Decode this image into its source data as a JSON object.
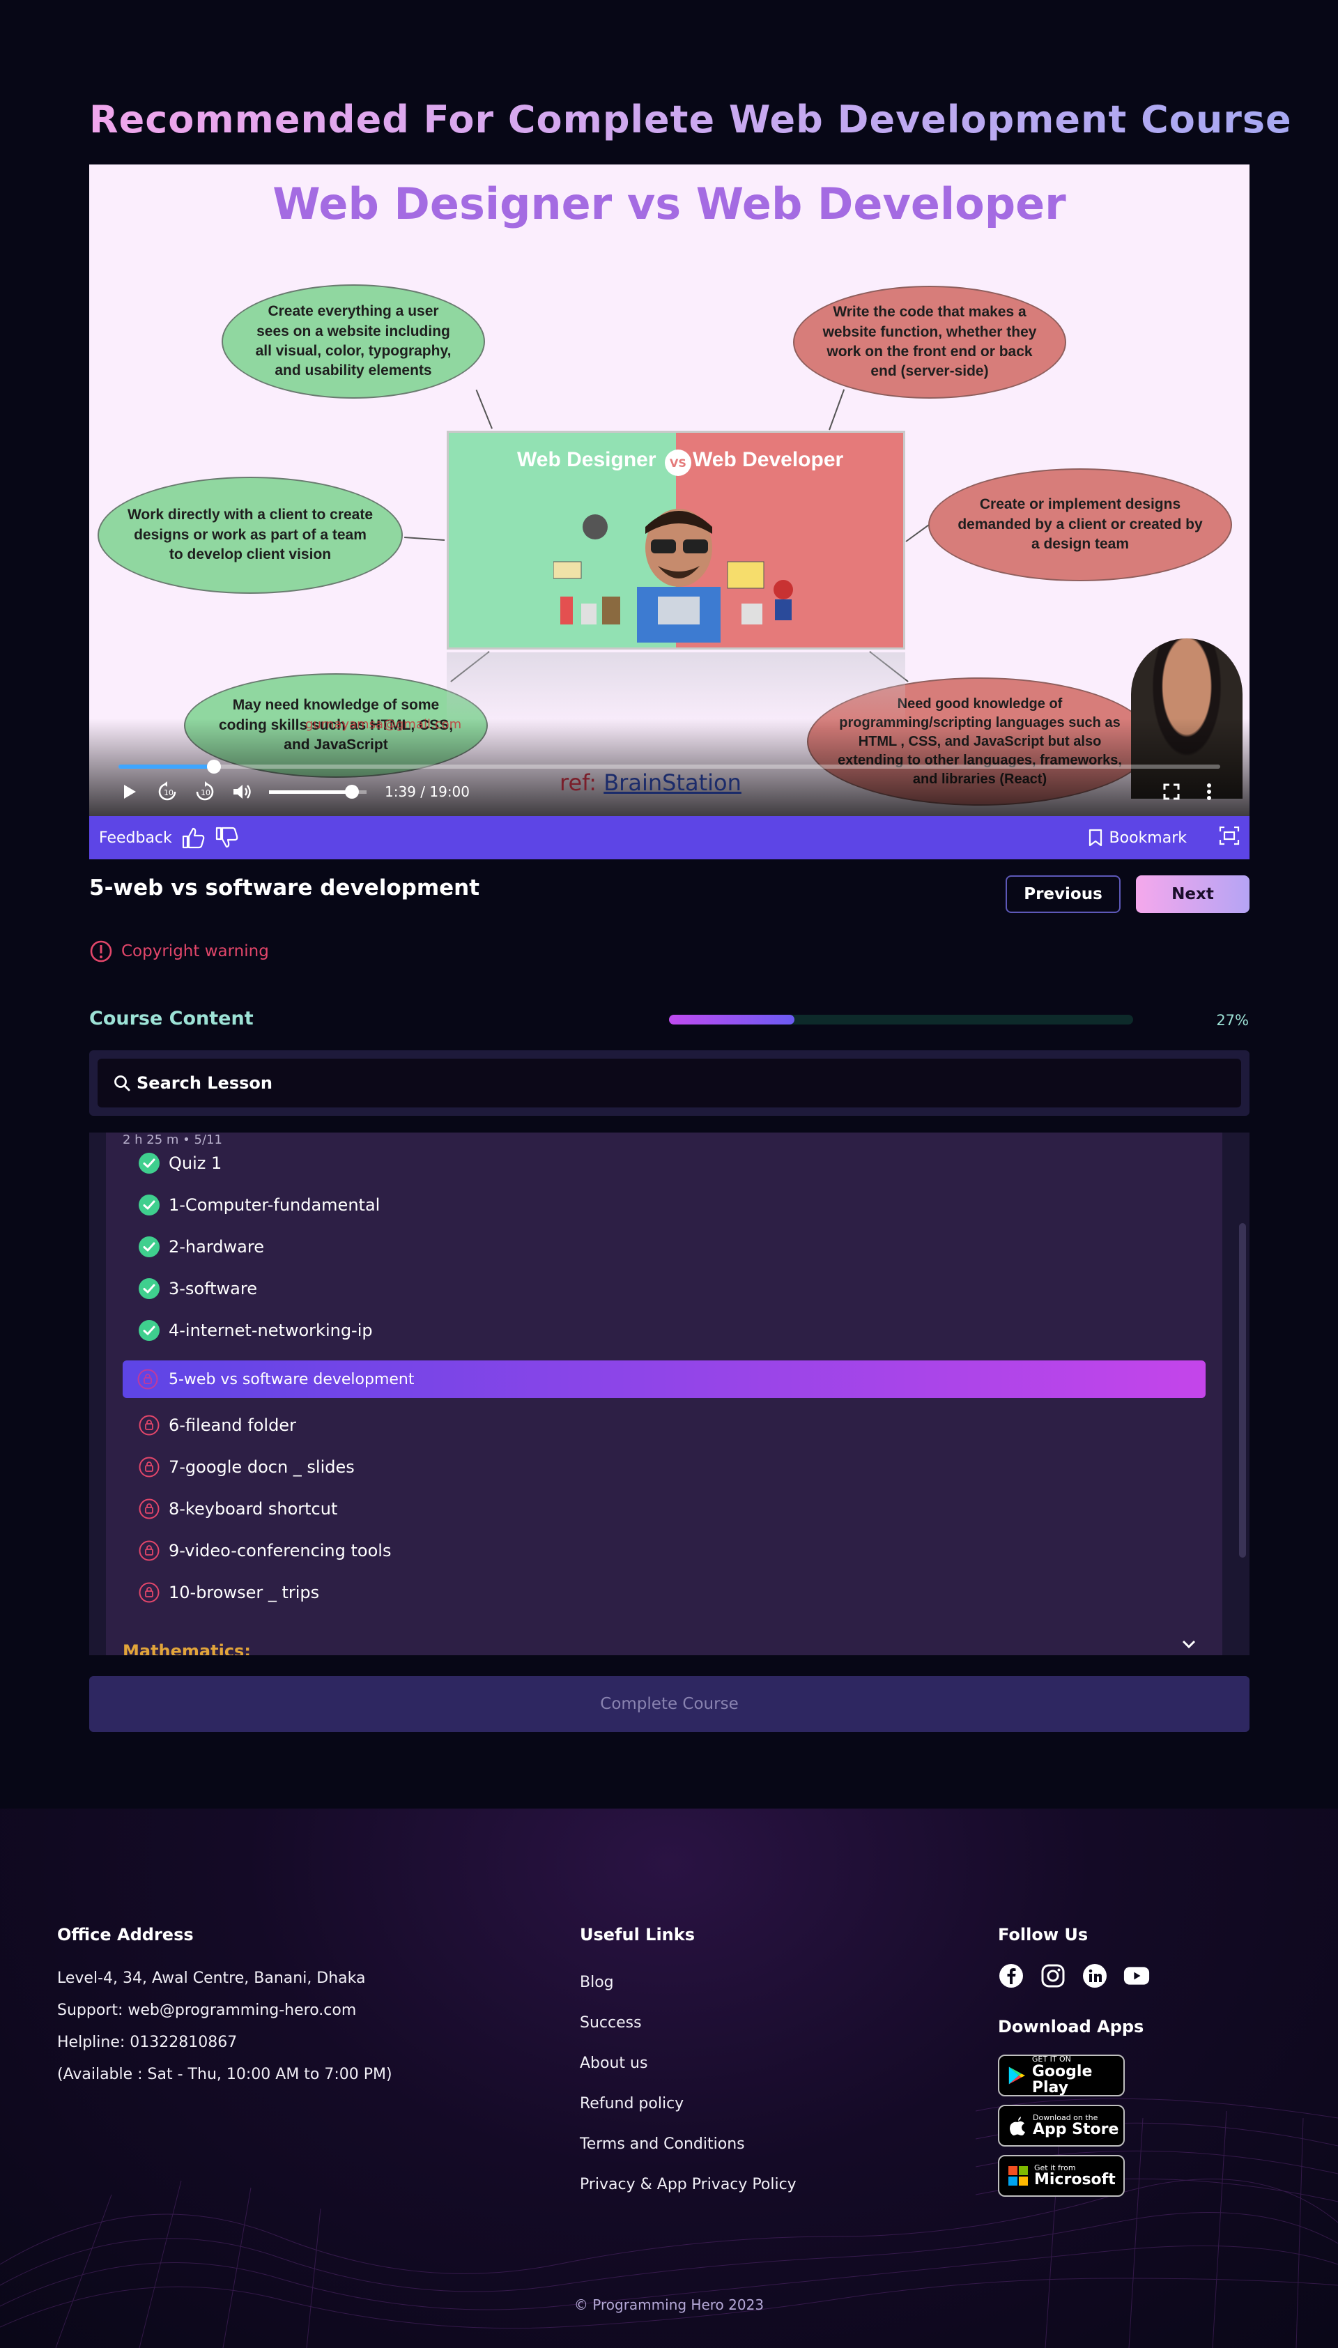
{
  "page": {
    "heading": "Recommended For Complete Web Development Course"
  },
  "video": {
    "slide_title": "Web Designer vs Web Developer",
    "bubbles": [
      "Create everything a user sees on a website including all visual, color, typography, and usability elements",
      "Write the code that makes a website function, whether they work on the front end or back end (server-side)",
      "Work directly with a client to create designs or work as part of a team to develop client vision",
      "Create or implement designs demanded by a client or created by a design team",
      "May need knowledge of some coding skills such as HTML, CSS, and JavaScript",
      "Need good knowledge of programming/scripting languages such as HTML , CSS, and JavaScript but also extending to other languages, frameworks, and libraries (React)"
    ],
    "center_left_label": "Web Designer",
    "center_vs": "VS",
    "center_right_label": "Web Developer",
    "ref_prefix": "ref: ",
    "ref_link": "BrainStation",
    "email_watermark": "gurnayamsa@gmail.com",
    "progress_fraction": 0.0868,
    "volume_fraction": 0.85,
    "time": "1:39 / 19:00"
  },
  "feedback_bar": {
    "feedback_label": "Feedback",
    "bookmark_label": "Bookmark"
  },
  "lesson": {
    "title": "5-web vs software development",
    "previous_label": "Previous",
    "next_label": "Next",
    "copyright_warning": "Copyright warning"
  },
  "course": {
    "label": "Course Content",
    "progress_fraction": 0.27,
    "progress_text": "27%",
    "search_label": "Search Lesson",
    "module_meta": "2 h 25 m •  5/11",
    "items_done": [
      "Quiz 1",
      "1-Computer-fundamental",
      "2-hardware",
      "3-software",
      "4-internet-networking-ip"
    ],
    "active_item": "5-web vs software development",
    "items_locked": [
      "6-fileand folder",
      "7-google docn _ slides",
      "8-keyboard shortcut",
      "9-video-conferencing tools",
      "10-browser _ trips"
    ],
    "next_section": "Mathematics:",
    "complete_label": "Complete Course"
  },
  "footer": {
    "office_title": "Office Address",
    "office_lines": [
      "Level-4, 34, Awal Centre, Banani, Dhaka",
      "Support: web@programming-hero.com",
      "Helpline: 01322810867",
      "(Available : Sat - Thu, 10:00 AM to 7:00 PM)"
    ],
    "links_title": "Useful Links",
    "links": [
      "Blog",
      "Success",
      "About us",
      "Refund policy",
      "Terms and Conditions",
      "Privacy & App Privacy Policy"
    ],
    "follow_title": "Follow Us",
    "apps_title": "Download Apps",
    "google_small": "GET IT ON",
    "google_big": "Google Play",
    "apple_small": "Download on the",
    "apple_big": "App Store",
    "ms_small": "Get it from",
    "ms_big": "Microsoft",
    "copyright": "© Programming Hero 2023"
  },
  "colors": {
    "accent": "#5d45e6",
    "active_gradient_end": "#c445ea",
    "done_check": "#3fcf8e",
    "locked": "#e2466a",
    "section_gold": "#e2a53a"
  }
}
